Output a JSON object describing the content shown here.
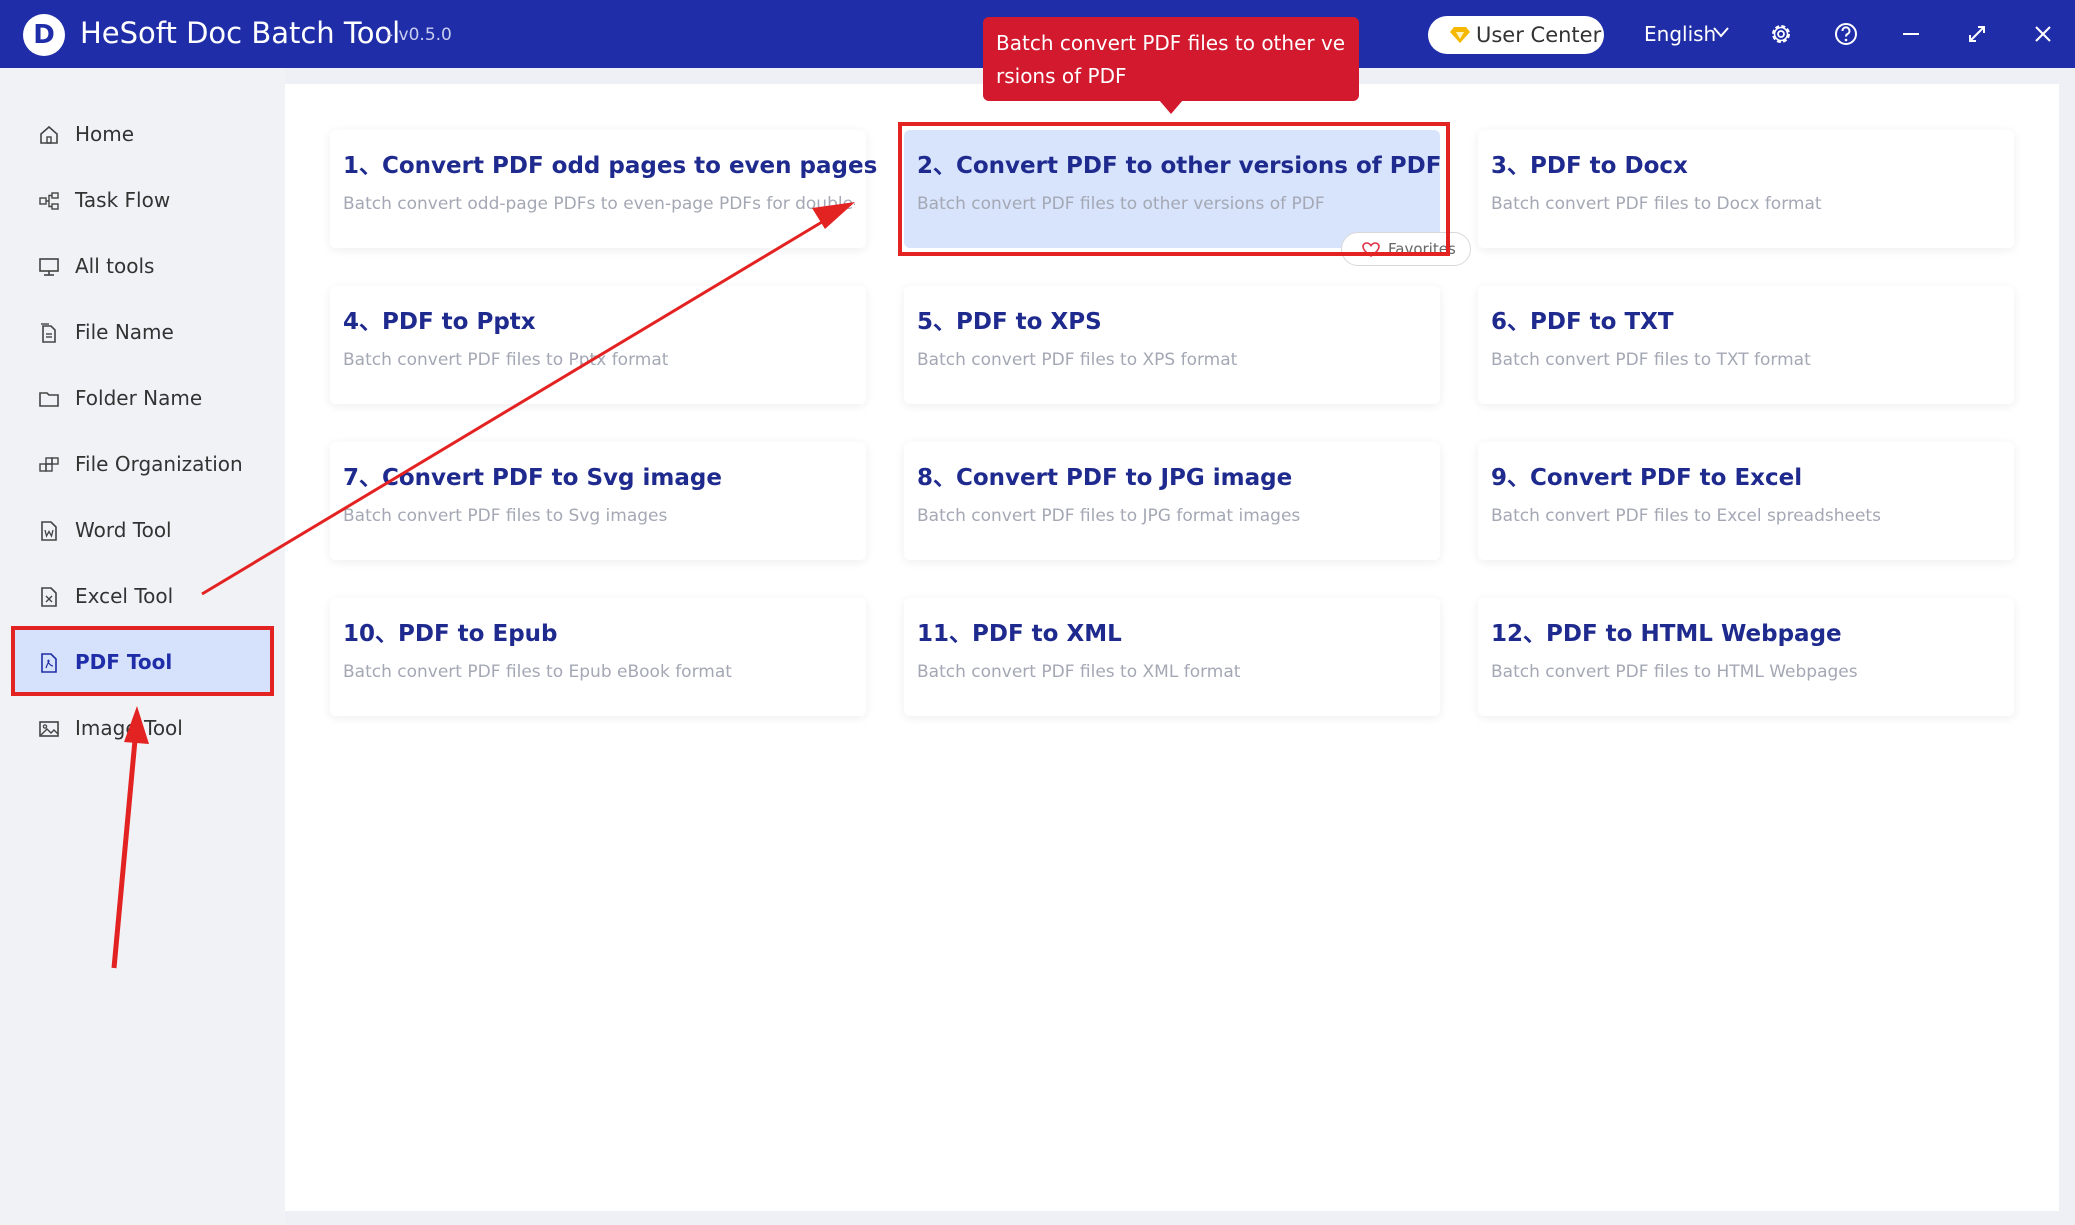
{
  "app": {
    "title": "HeSoft Doc Batch Tool",
    "version": "- v0.5.0",
    "logo_letter": "D"
  },
  "header": {
    "user_center": "User Center",
    "language": "English"
  },
  "sidebar": {
    "items": [
      {
        "label": "Home",
        "icon": "home-icon"
      },
      {
        "label": "Task Flow",
        "icon": "task-flow-icon"
      },
      {
        "label": "All tools",
        "icon": "monitor-icon"
      },
      {
        "label": "File Name",
        "icon": "file-name-icon"
      },
      {
        "label": "Folder Name",
        "icon": "folder-icon"
      },
      {
        "label": "File Organization",
        "icon": "file-organization-icon"
      },
      {
        "label": "Word Tool",
        "icon": "word-file-icon"
      },
      {
        "label": "Excel Tool",
        "icon": "excel-file-icon"
      },
      {
        "label": "PDF Tool",
        "icon": "pdf-file-icon",
        "active": true
      },
      {
        "label": "Image Tool",
        "icon": "image-icon"
      }
    ]
  },
  "tools": [
    {
      "title": "1、Convert PDF odd pages to even pages",
      "desc": "Batch convert odd-page PDFs to even-page PDFs for double-si"
    },
    {
      "title": "2、Convert PDF to other versions of PDF",
      "desc": "Batch convert PDF files to other versions of PDF",
      "selected": true
    },
    {
      "title": "3、PDF to Docx",
      "desc": "Batch convert PDF files to Docx format"
    },
    {
      "title": "4、PDF to Pptx",
      "desc": "Batch convert PDF files to Pptx format"
    },
    {
      "title": "5、PDF to XPS",
      "desc": "Batch convert PDF files to XPS format"
    },
    {
      "title": "6、PDF to TXT",
      "desc": "Batch convert PDF files to TXT format"
    },
    {
      "title": "7、Convert PDF to Svg image",
      "desc": "Batch convert PDF files to Svg images"
    },
    {
      "title": "8、Convert PDF to JPG image",
      "desc": "Batch convert PDF files to JPG format images"
    },
    {
      "title": "9、Convert PDF to Excel",
      "desc": "Batch convert PDF files to Excel spreadsheets"
    },
    {
      "title": "10、PDF to Epub",
      "desc": "Batch convert PDF files to Epub eBook format"
    },
    {
      "title": "11、PDF to XML",
      "desc": "Batch convert PDF files to XML format"
    },
    {
      "title": "12、PDF to HTML Webpage",
      "desc": "Batch convert PDF files to HTML Webpages"
    }
  ],
  "favorite_label": "Favorites",
  "tooltip": "Batch convert PDF files to other versions of PDF",
  "colors": {
    "titlebar": "#1f2ea8",
    "accent": "#1f2a8e",
    "active_bg": "#d6e2fb",
    "annotation_red": "#e32222",
    "tooltip_red": "#d2192e"
  }
}
